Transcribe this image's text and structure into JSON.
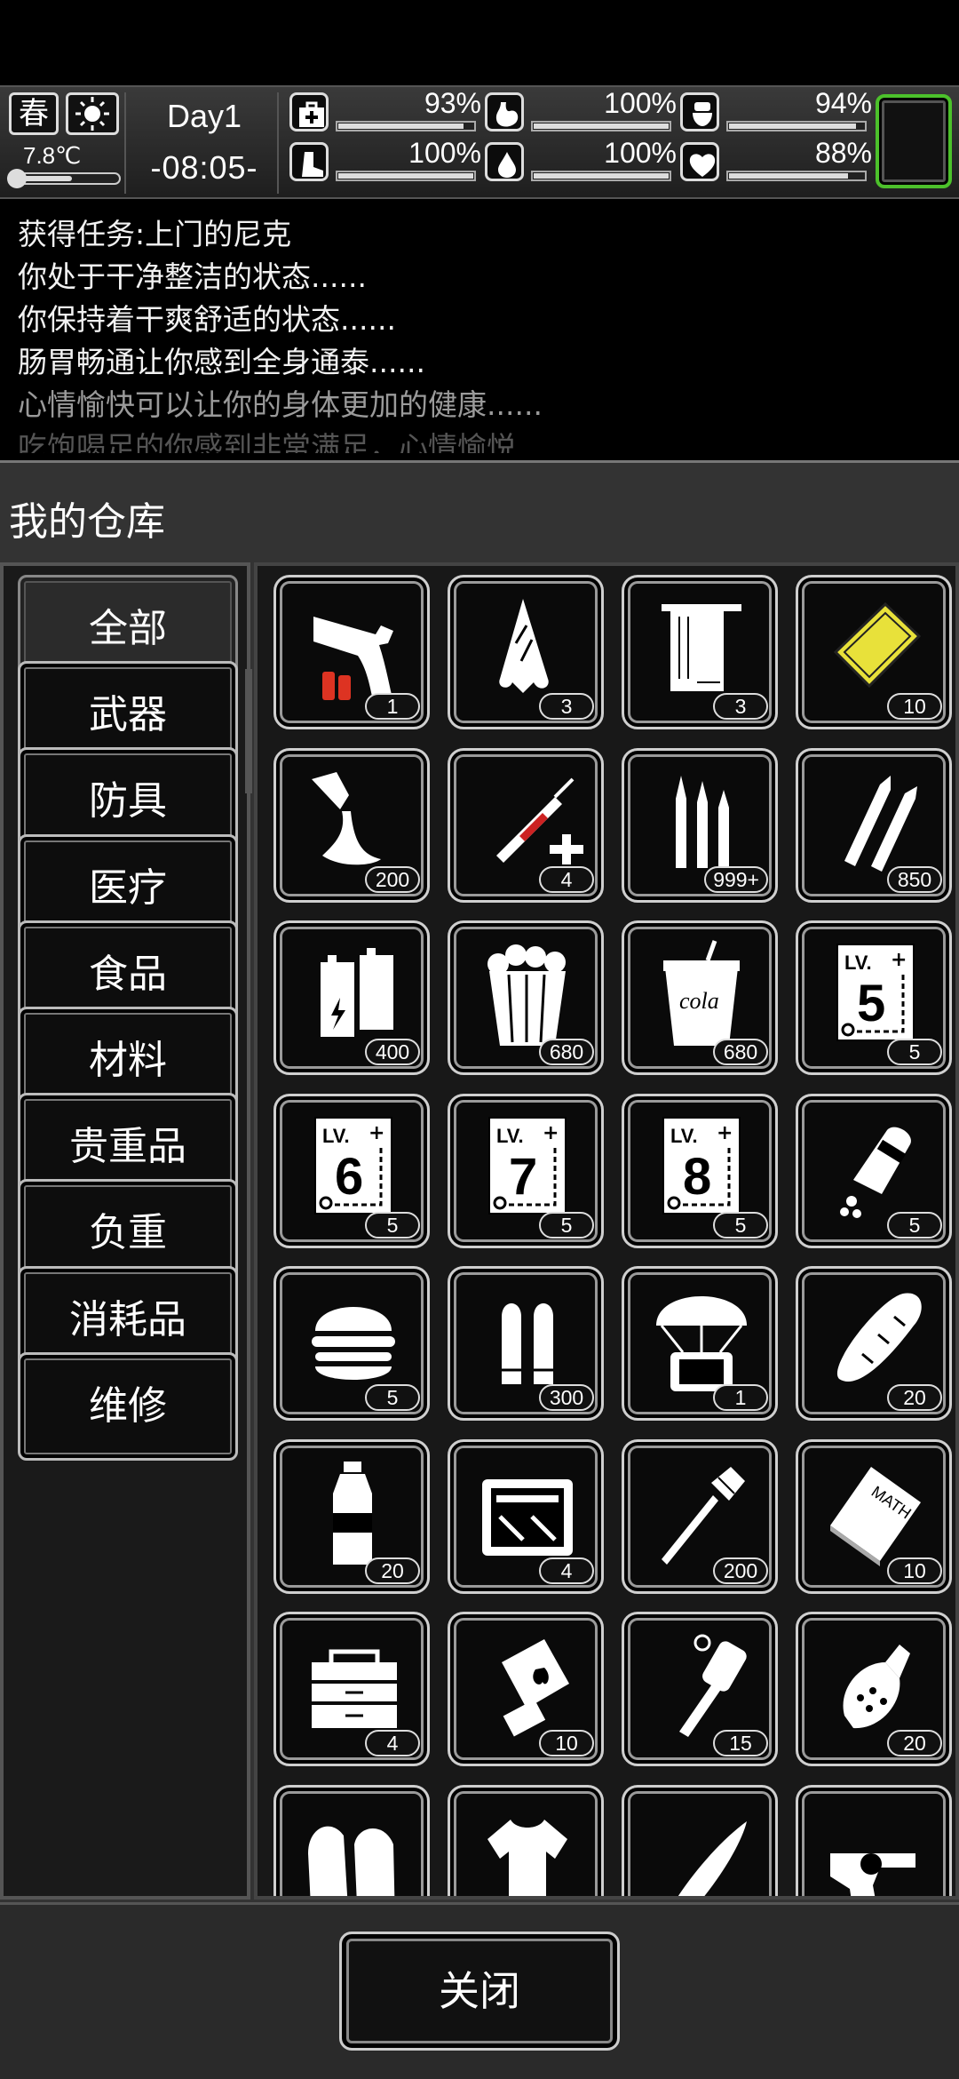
{
  "hud": {
    "season": "春",
    "weather_icon": "sun-icon",
    "temperature": "7.8℃",
    "temperature_level": 0.55,
    "day": "Day1",
    "time": "-08:05-",
    "stats": [
      {
        "name": "health",
        "icon": "medkit-icon",
        "value": "93%",
        "level": 0.93
      },
      {
        "name": "hunger",
        "icon": "stomach-icon",
        "value": "100%",
        "level": 1.0
      },
      {
        "name": "toilet",
        "icon": "toilet-icon",
        "value": "94%",
        "level": 0.94
      },
      {
        "name": "stamina",
        "icon": "boot-icon",
        "value": "100%",
        "level": 1.0
      },
      {
        "name": "thirst",
        "icon": "water-drop-icon",
        "value": "100%",
        "level": 1.0
      },
      {
        "name": "mood",
        "icon": "heart-icon",
        "value": "88%",
        "level": 0.88
      }
    ],
    "slot_border_color": "#4cc12b"
  },
  "log": [
    "获得任务:上门的尼克",
    "你处于干净整洁的状态......",
    "你保持着干爽舒适的状态......",
    "肠胃畅通让你感到全身通泰......",
    "心情愉快可以让你的身体更加的健康......",
    "吃饱喝足的你感到非常满足，心情愉悦"
  ],
  "warehouse": {
    "title": "我的仓库",
    "categories": [
      "全部",
      "武器",
      "防具",
      "医疗",
      "食品",
      "材料",
      "贵重品",
      "负重",
      "消耗品",
      "维修"
    ],
    "active_category": "全部",
    "items": [
      {
        "icon": "flare-gun-icon",
        "count": "1"
      },
      {
        "icon": "cloth-rag-icon",
        "count": "3"
      },
      {
        "icon": "towel-icon",
        "count": "3"
      },
      {
        "icon": "gold-card-icon",
        "count": "10"
      },
      {
        "icon": "glue-tube-icon",
        "count": "200"
      },
      {
        "icon": "syringe-icon",
        "count": "4"
      },
      {
        "icon": "rifle-bullets-icon",
        "count": "999+"
      },
      {
        "icon": "sniper-bullets-icon",
        "count": "850"
      },
      {
        "icon": "battery-icon",
        "count": "400"
      },
      {
        "icon": "popcorn-icon",
        "count": "680"
      },
      {
        "icon": "cola-cup-icon",
        "count": "680",
        "label": "cola"
      },
      {
        "icon": "skill-book-lv5-icon",
        "count": "5",
        "level": "5"
      },
      {
        "icon": "skill-book-lv6-icon",
        "count": "5",
        "level": "6"
      },
      {
        "icon": "skill-book-lv7-icon",
        "count": "5",
        "level": "7"
      },
      {
        "icon": "skill-book-lv8-icon",
        "count": "5",
        "level": "8"
      },
      {
        "icon": "pill-bottle-icon",
        "count": "5"
      },
      {
        "icon": "burger-icon",
        "count": "5"
      },
      {
        "icon": "pistol-bullets-icon",
        "count": "300"
      },
      {
        "icon": "airdrop-icon",
        "count": "1"
      },
      {
        "icon": "bread-icon",
        "count": "20"
      },
      {
        "icon": "water-bottle-icon",
        "count": "20"
      },
      {
        "icon": "toolbox-icon",
        "count": "4"
      },
      {
        "icon": "rocket-icon",
        "count": "200"
      },
      {
        "icon": "math-book-icon",
        "count": "10",
        "label": "MATH"
      },
      {
        "icon": "tool-chest-icon",
        "count": "4"
      },
      {
        "icon": "fuel-can-icon",
        "count": "10"
      },
      {
        "icon": "stick-grenade-icon",
        "count": "15"
      },
      {
        "icon": "grenade-icon",
        "count": "20"
      },
      {
        "icon": "gloves-icon",
        "count": ""
      },
      {
        "icon": "shirt-icon",
        "count": ""
      },
      {
        "icon": "machete-icon",
        "count": ""
      },
      {
        "icon": "revolver-icon",
        "count": ""
      }
    ],
    "close_label": "关闭",
    "lv_prefix": "LV."
  }
}
